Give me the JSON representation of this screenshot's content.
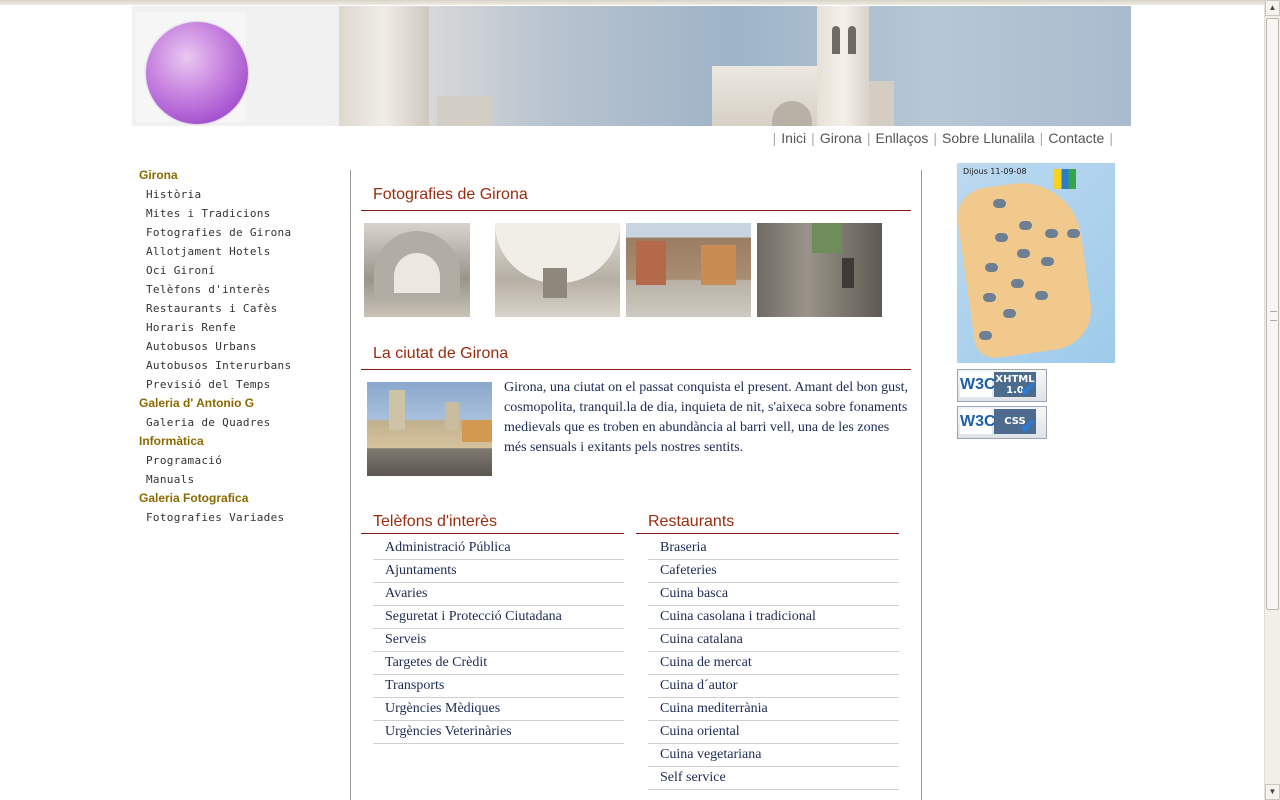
{
  "nav": {
    "items": [
      "Inici",
      "Girona",
      "Enllaços",
      "Sobre Llunalila",
      "Contacte"
    ]
  },
  "sidebar": {
    "sections": [
      {
        "title": "Girona",
        "items": [
          "Història",
          "Mites i Tradicions",
          "Fotografies de Girona",
          "Allotjament Hotels",
          "Oci Gironí",
          "Telèfons d'interès",
          "Restaurants i Cafès",
          "Horaris Renfe",
          "Autobusos Urbans",
          "Autobusos Interurbans",
          "Previsió del Temps"
        ]
      },
      {
        "title": "Galeria d' Antonio G",
        "items": [
          "Galeria de Quadres"
        ]
      },
      {
        "title": "Informàtica",
        "items": [
          "Programació",
          "Manuals"
        ]
      },
      {
        "title": "Galeria Fotografica",
        "items": [
          "Fotografies Variades"
        ]
      }
    ]
  },
  "main": {
    "photos_title": "Fotografies de Girona",
    "city_title": "La ciutat de Girona",
    "city_text": "Girona, una ciutat on el passat conquista el present. Amant del bon gust, cosmopolita, tranquil.la de dia, inquieta de nit, s'aixeca sobre fonaments medievals que es troben en abundància al barri vell, una de les zones més sensuals i exitants pels nostres sentits.",
    "phones_title": "Telèfons d'interès",
    "phones": [
      "Administració Pública",
      "Ajuntaments",
      "Avaries",
      "Seguretat i Protecció Ciutadana",
      "Serveis",
      "Targetes de Crèdit",
      "Transports",
      "Urgències Mèdiques",
      "Urgències Veterinàries"
    ],
    "rest_title": "Restaurants",
    "restaurants": [
      "Braseria",
      "Cafeteries",
      "Cuina basca",
      "Cuina casolana i tradicional",
      "Cuina catalana",
      "Cuina de mercat",
      "Cuina d´autor",
      "Cuina mediterrània",
      "Cuina oriental",
      "Cuina vegetariana",
      "Self service"
    ]
  },
  "right": {
    "weather_header": "Dijous 11-09-08",
    "badge_xhtml": "XHTML 1.0",
    "badge_css": "CSS",
    "w3c": "W3C"
  }
}
